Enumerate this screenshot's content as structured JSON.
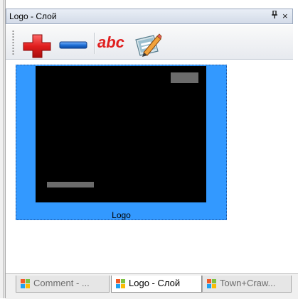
{
  "panel": {
    "title": "Logo - Слой",
    "pin_glyph": "ᴛ",
    "close_glyph": "×"
  },
  "toolbar": {
    "add_icon": "red-plus-icon",
    "remove_icon": "blue-minus-icon",
    "rename_label": "abc",
    "edit_icon": "edit-pencil-icon"
  },
  "layers": [
    {
      "label": "Logo",
      "selected": true,
      "color": "#3399ff"
    }
  ],
  "tabs": [
    {
      "label": "Comment - ...",
      "active": false
    },
    {
      "label": "Logo - Слой",
      "active": true
    },
    {
      "label": "Town+Craw...",
      "active": false
    }
  ],
  "colors": {
    "selection": "#3399ff",
    "thumbnail_bg": "#000000",
    "thumbnail_marks": "#6b6b6b",
    "plus": "#e02020",
    "minus": "#1f6fd6"
  }
}
